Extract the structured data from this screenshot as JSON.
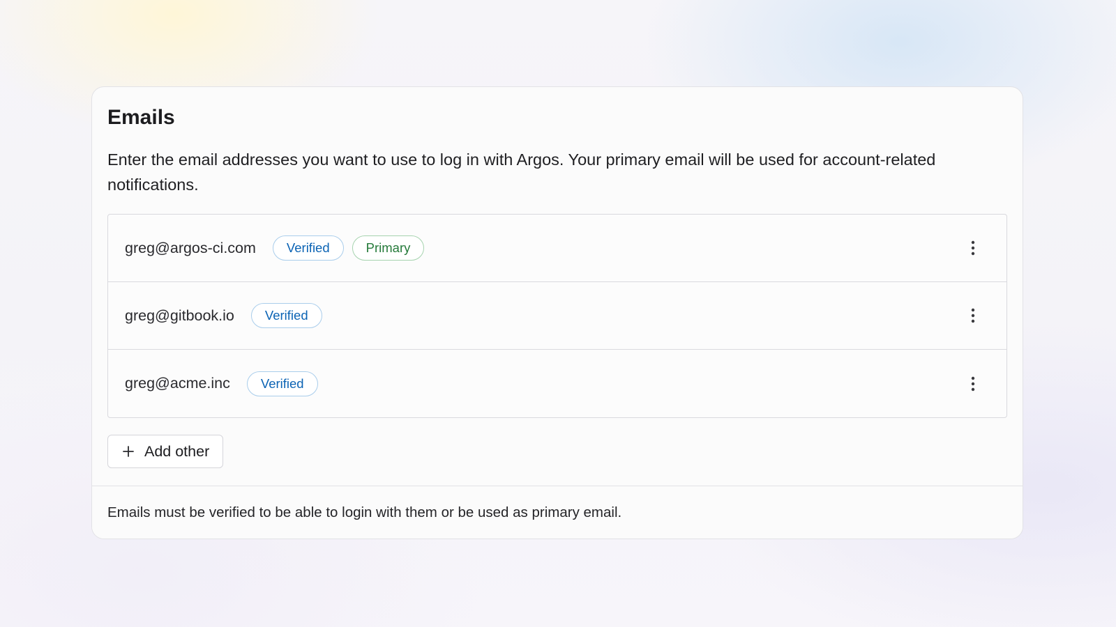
{
  "section": {
    "title": "Emails",
    "description": "Enter the email addresses you want to use to log in with Argos. Your primary email will be used for account-related notifications."
  },
  "emails": [
    {
      "address": "greg@argos-ci.com",
      "badges": [
        "Verified",
        "Primary"
      ],
      "menu_icon": "more-vertical-icon"
    },
    {
      "address": "greg@gitbook.io",
      "badges": [
        "Verified"
      ],
      "menu_icon": "more-vertical-icon"
    },
    {
      "address": "greg@acme.inc",
      "badges": [
        "Verified"
      ],
      "menu_icon": "more-vertical-icon"
    }
  ],
  "add_button": {
    "label": "Add other",
    "icon": "plus-icon"
  },
  "footer": {
    "text": "Emails must be verified to be able to login with them or be used as primary email."
  },
  "colors": {
    "verified_text": "#0b63b4",
    "verified_border": "#a9cdeb",
    "primary_text": "#257a3a",
    "primary_border": "#a5d3ae",
    "card_background": "#fbfbfb",
    "border": "#d9d9de"
  }
}
